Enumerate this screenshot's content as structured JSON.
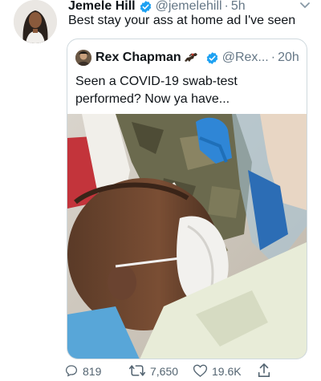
{
  "tweet": {
    "author_name": "Jemele Hill",
    "handle": "@jemelehill",
    "separator": "·",
    "time": "5h",
    "text": "Best stay your ass at home ad I've seen"
  },
  "quoted": {
    "author_name": "Rex Chapman",
    "handle": "@Rex...",
    "separator": "·",
    "time": "20h",
    "text": "Seen a COVID-19 swab-test performed? Now ya have..."
  },
  "actions": {
    "replies": "819",
    "retweets": "7,650",
    "likes": "19.6K"
  },
  "colors": {
    "verified": "#1da1f2",
    "muted": "#657786",
    "border": "#cfd9de"
  },
  "icons": [
    "verified-badge-icon",
    "chevron-down-icon",
    "horse-emoji-icon",
    "reply-icon",
    "retweet-icon",
    "like-icon",
    "share-icon"
  ]
}
